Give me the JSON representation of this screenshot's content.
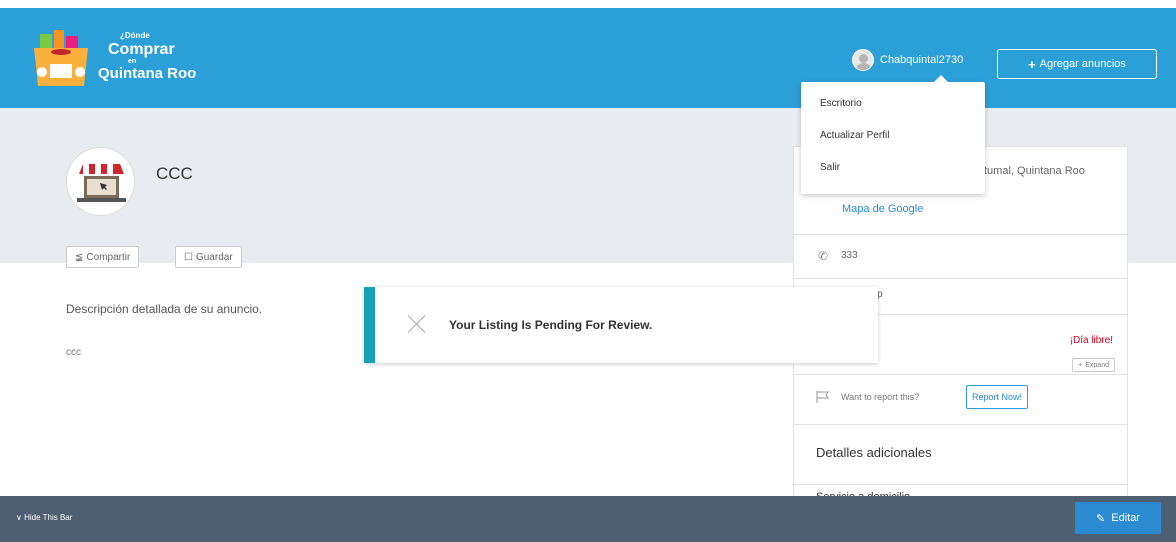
{
  "header": {
    "logo": {
      "line1": "¿Dónde",
      "line2": "Comprar",
      "line3": "en",
      "line4": "Quintana Roo"
    },
    "username": "Chabquintal2730",
    "add_listing_label": "Agregar anuncios"
  },
  "dropdown": {
    "items": [
      "Escritorio",
      "Actualizar Perfil",
      "Salir"
    ]
  },
  "listing": {
    "title": "CCC",
    "share_label": "Compartir",
    "save_label": "Guardar",
    "description_heading": "Descripción detallada de su anuncio.",
    "description_value": "ccc"
  },
  "sidebar": {
    "address": "tumal, Quintana Roo",
    "map_link": "Mapa de Google",
    "phone": "333",
    "whatsapp": "app",
    "hours_status": "¡Día libre!",
    "expand_label": "Expand",
    "report_text": "Want to report this?",
    "report_button": "Report Now!",
    "extra_title": "Detalles adicionales",
    "extra_peek": "Servicio a domicilio"
  },
  "toast": {
    "message": "Your Listing Is Pending For Review."
  },
  "bottom_bar": {
    "hide_label": "Hide This Bar",
    "edit_label": "Editar"
  },
  "colors": {
    "header": "#2b9fd8",
    "toast_accent": "#14a3b5",
    "bottom_bar": "#4d5f70",
    "edit_button": "#2b8bd1",
    "status_red": "#d0021b"
  }
}
